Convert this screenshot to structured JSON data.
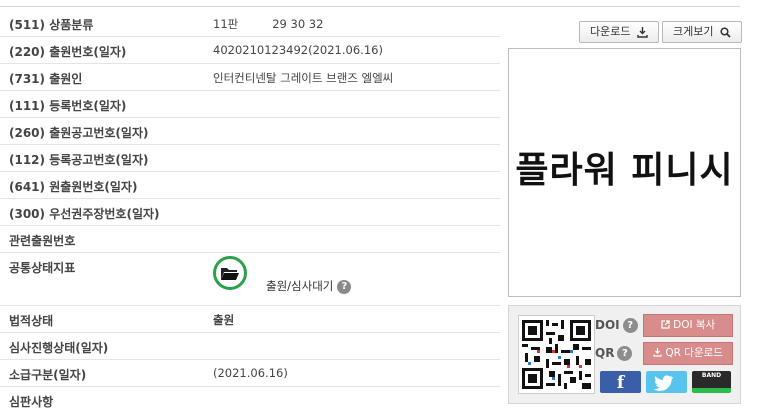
{
  "rows": [
    {
      "label": "(511) 상품분류",
      "edition": "11판",
      "classes": "29 30 32"
    },
    {
      "label": "(220) 출원번호(일자)",
      "value": "4020210123492(2021.06.16)"
    },
    {
      "label": "(731) 출원인",
      "value": "인터컨티넨탈 그레이트 브랜즈 엘엘씨"
    },
    {
      "label": "(111) 등록번호(일자)",
      "value": ""
    },
    {
      "label": "(260) 출원공고번호(일자)",
      "value": ""
    },
    {
      "label": "(112) 등록공고번호(일자)",
      "value": ""
    },
    {
      "label": "(641) 원출원번호(일자)",
      "value": ""
    },
    {
      "label": "(300) 우선권주장번호(일자)",
      "value": ""
    },
    {
      "label": "관련출원번호",
      "value": ""
    },
    {
      "label": "공통상태지표",
      "status": "출원/심사대기"
    },
    {
      "label": "법적상태",
      "value": "출원"
    },
    {
      "label": "심사진행상태(일자)",
      "value": ""
    },
    {
      "label": "소급구분(일자)",
      "value": "(2021.06.16)"
    },
    {
      "label": "심판사항",
      "value": ""
    }
  ],
  "buttons": {
    "download": "다운로드",
    "zoom": "크게보기"
  },
  "trademark_text": "플라워 피니시",
  "share": {
    "doi_label": "DOI",
    "qr_label": "QR",
    "doi_copy": "DOI 복사",
    "qr_download": "QR 다운로드",
    "facebook": "f",
    "band": "BAND"
  },
  "help_mark": "?",
  "colors": {
    "status_ring": "#2aa14a",
    "pink_button": "#d98c8c",
    "facebook": "#3b5ea8",
    "twitter": "#58c3ec"
  }
}
